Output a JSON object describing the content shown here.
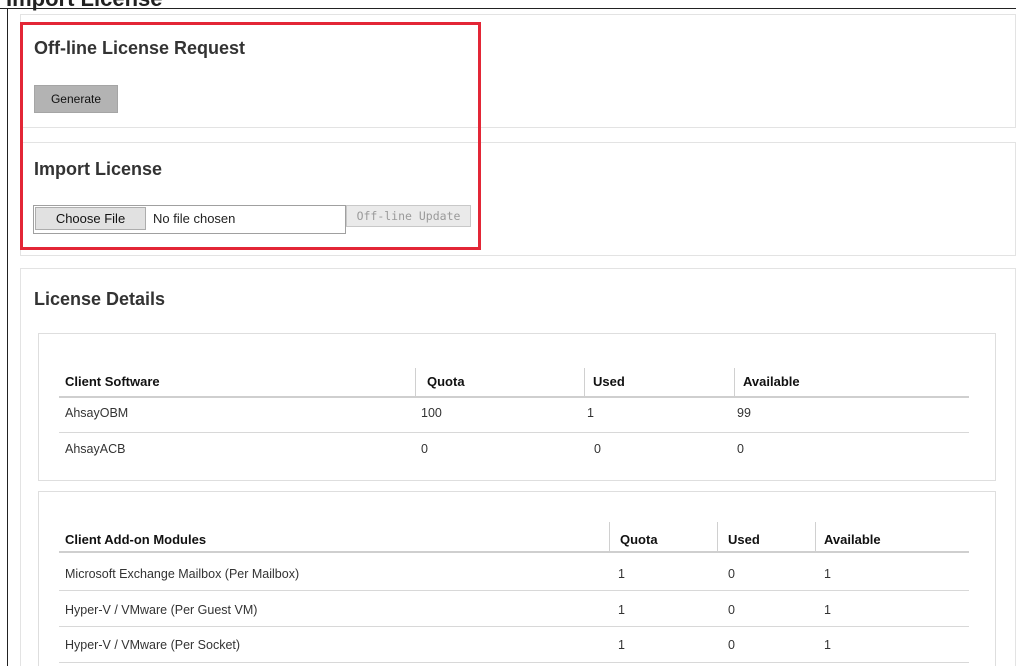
{
  "page": {
    "cut_title": "Import License"
  },
  "offline_request": {
    "title": "Off-line License Request",
    "generate_label": "Generate"
  },
  "import": {
    "title": "Import License",
    "choose_label": "Choose File",
    "no_file": "No file chosen",
    "update_label": "Off-line Update"
  },
  "details": {
    "title": "License Details",
    "client_software": {
      "headers": [
        "Client Software",
        "Quota",
        "Used",
        "Available"
      ],
      "rows": [
        [
          "AhsayOBM",
          "100",
          "1",
          "99"
        ],
        [
          "AhsayACB",
          "0",
          "0",
          "0"
        ]
      ]
    },
    "addons": {
      "headers": [
        "Client Add-on Modules",
        "Quota",
        "Used",
        "Available"
      ],
      "rows": [
        [
          "Microsoft Exchange Mailbox (Per Mailbox)",
          "1",
          "0",
          "1"
        ],
        [
          "Hyper-V / VMware (Per Guest VM)",
          "1",
          "0",
          "1"
        ],
        [
          "Hyper-V / VMware (Per Socket)",
          "1",
          "0",
          "1"
        ]
      ]
    }
  },
  "colors": {
    "highlight": "#e32636",
    "button_gray": "#b3b3b3"
  }
}
